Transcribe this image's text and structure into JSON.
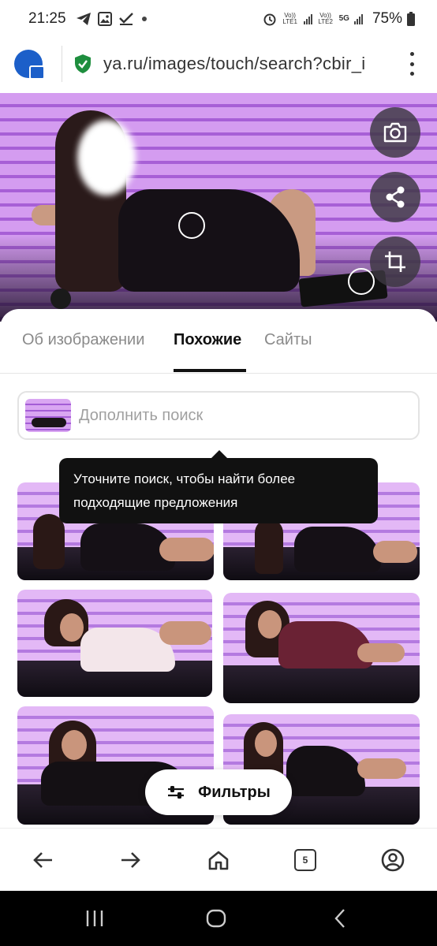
{
  "status_bar": {
    "time": "21:25",
    "left_icons": [
      "telegram-icon",
      "gallery-icon",
      "check-icon",
      "dot-icon"
    ],
    "right_icons": [
      "alarm-icon",
      "volte-lte1-icon",
      "signal-icon",
      "volte-lte2-icon",
      "5g-icon",
      "signal-icon"
    ],
    "lte1_label": "Vo)) LTE1",
    "lte2_label": "Vo)) LTE2",
    "network_label": "5G",
    "battery": "75%"
  },
  "url_bar": {
    "url": "ya.ru/images/touch/search?cbir_i",
    "site_icon": "globe-lock-icon",
    "security_icon": "shield-check-icon",
    "menu_icon": "more-vert-icon"
  },
  "hero": {
    "actions": [
      "camera-lens-icon",
      "share-icon",
      "crop-icon"
    ]
  },
  "tabs": {
    "items": [
      {
        "label": "Об изображении",
        "active": false
      },
      {
        "label": "Похожие",
        "active": true
      },
      {
        "label": "Сайты",
        "active": false
      }
    ]
  },
  "search": {
    "placeholder": "Дополнить поиск"
  },
  "tooltip": {
    "text": "Уточните поиск, чтобы найти более подходящие предложения"
  },
  "filters": {
    "label": "Фильтры",
    "icon": "sliders-icon"
  },
  "browser_nav": {
    "tab_count": "5",
    "icons": [
      "back-arrow-icon",
      "forward-arrow-icon",
      "home-icon",
      "tabs-icon",
      "profile-icon"
    ]
  },
  "system_nav": {
    "icons": [
      "recents-icon",
      "home-circle-icon",
      "back-chevron-icon"
    ]
  },
  "colors": {
    "accent_purple": "#b070e0",
    "text_dark": "#111111",
    "text_muted": "#8a8a8a",
    "shield_green": "#1e8e3e",
    "globe_blue": "#1c5fc9"
  }
}
